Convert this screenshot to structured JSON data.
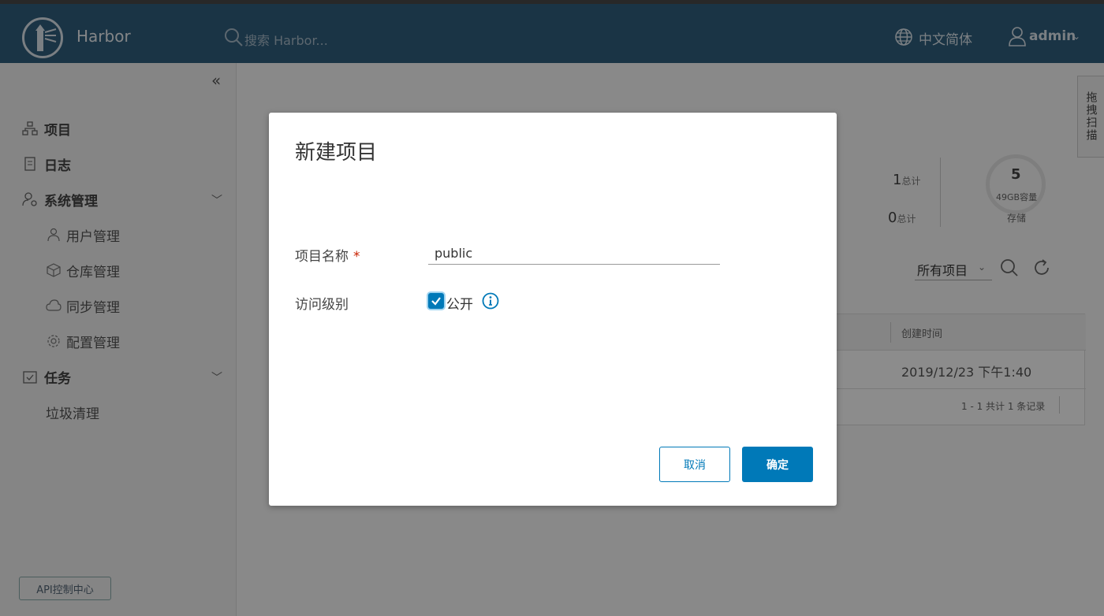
{
  "header": {
    "brand": "Harbor",
    "search_placeholder": "搜索 Harbor...",
    "language": "中文简体",
    "user": "admin"
  },
  "sidebar": {
    "items": [
      {
        "label": "项目",
        "icon": "project-icon"
      },
      {
        "label": "日志",
        "icon": "log-icon"
      },
      {
        "label": "系统管理",
        "icon": "admin-icon"
      },
      {
        "label": "用户管理",
        "icon": "users-icon"
      },
      {
        "label": "仓库管理",
        "icon": "box-icon"
      },
      {
        "label": "同步管理",
        "icon": "cloud-icon"
      },
      {
        "label": "配置管理",
        "icon": "gear-icon"
      },
      {
        "label": "任务",
        "icon": "task-icon"
      },
      {
        "label": "垃圾清理",
        "icon": ""
      }
    ],
    "api_button": "API控制中心"
  },
  "summary": {
    "stat1_value": "1",
    "stat1_label": "总计",
    "stat2_value": "0",
    "stat2_label": "总计",
    "storage_value": "5",
    "storage_capacity": "49GB容量",
    "storage_caption": "存储"
  },
  "toolbar": {
    "filter": "所有项目"
  },
  "table": {
    "column_header": "创建时间",
    "row_value": "2019/12/23 下午1:40",
    "footer": "1 - 1 共计 1 条记录"
  },
  "side_tab": "拖拽扫描",
  "modal": {
    "title": "新建项目",
    "name_label": "项目名称",
    "required_mark": "*",
    "name_value": "public",
    "access_label": "访问级别",
    "public_label": "公开",
    "public_checked": true,
    "cancel": "取消",
    "confirm": "确定"
  },
  "colors": {
    "header_bg": "#315f7e",
    "primary": "#0079b8",
    "required": "#c92100"
  }
}
